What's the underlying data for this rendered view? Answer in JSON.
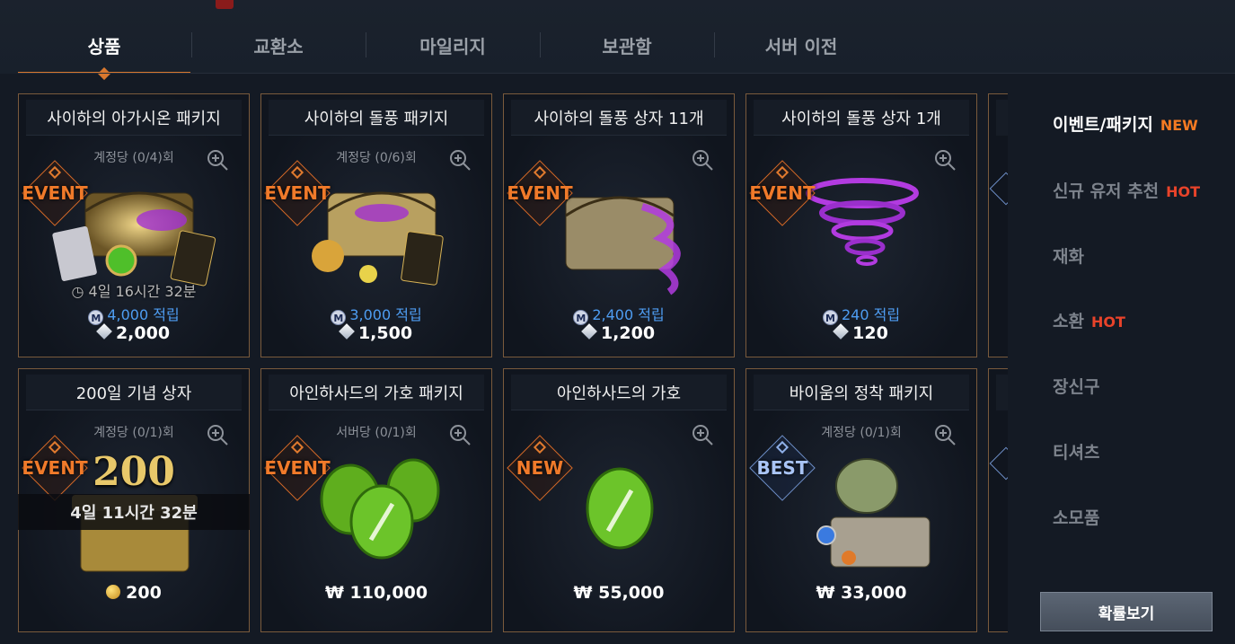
{
  "tabs": [
    {
      "label": "상품",
      "active": true
    },
    {
      "label": "교환소",
      "active": false
    },
    {
      "label": "마일리지",
      "active": false
    },
    {
      "label": "보관함",
      "active": false
    },
    {
      "label": "서버 이전",
      "active": false
    }
  ],
  "products": [
    {
      "title": "사이하의 아가시온 패키지",
      "limit": "계정당 (0/4)회",
      "badge": "EVENT",
      "timer": "4일 16시간 32분",
      "mileage": "4,000",
      "mileage_suffix": "적립",
      "price": "2,000",
      "currency": "diamond"
    },
    {
      "title": "사이하의 돌풍 패키지",
      "limit": "계정당 (0/6)회",
      "badge": "EVENT",
      "timer": "",
      "mileage": "3,000",
      "mileage_suffix": "적립",
      "price": "1,500",
      "currency": "diamond"
    },
    {
      "title": "사이하의 돌풍 상자 11개",
      "limit": "",
      "badge": "EVENT",
      "timer": "",
      "mileage": "2,400",
      "mileage_suffix": "적립",
      "price": "1,200",
      "currency": "diamond"
    },
    {
      "title": "사이하의 돌풍 상자 1개",
      "limit": "",
      "badge": "EVENT",
      "timer": "",
      "mileage": "240",
      "mileage_suffix": "적립",
      "price": "120",
      "currency": "diamond"
    },
    {
      "title": "200일 기념 상자",
      "limit": "계정당 (0/1)회",
      "badge": "EVENT",
      "timer": "4일 11시간 32분",
      "mileage": "",
      "price": "200",
      "currency": "gold"
    },
    {
      "title": "아인하사드의 가호 패키지",
      "limit": "서버당 (0/1)회",
      "badge": "EVENT",
      "timer": "",
      "mileage": "",
      "price": "₩ 110,000",
      "currency": "won"
    },
    {
      "title": "아인하사드의 가호",
      "limit": "",
      "badge": "NEW",
      "timer": "",
      "mileage": "",
      "price": "₩ 55,000",
      "currency": "won"
    },
    {
      "title": "바이움의 정착 패키지",
      "limit": "계정당 (0/1)회",
      "badge": "BEST",
      "timer": "",
      "mileage": "",
      "price": "₩ 33,000",
      "currency": "won"
    }
  ],
  "sidebar": {
    "items": [
      {
        "label": "이벤트/패키지",
        "tag": "NEW",
        "active": true
      },
      {
        "label": "신규 유저 추천",
        "tag": "HOT",
        "active": false
      },
      {
        "label": "재화",
        "tag": "",
        "active": false
      },
      {
        "label": "소환",
        "tag": "HOT",
        "active": false
      },
      {
        "label": "장신구",
        "tag": "",
        "active": false
      },
      {
        "label": "티셔츠",
        "tag": "",
        "active": false
      },
      {
        "label": "소모품",
        "tag": "",
        "active": false
      }
    ],
    "probability_button": "확률보기"
  },
  "colors": {
    "accent": "#d9782e",
    "event_badge": "#f07a2a",
    "best_badge": "#a9c4f5",
    "mileage": "#4e9df2",
    "hot": "#e8432a",
    "new": "#f47a22"
  }
}
